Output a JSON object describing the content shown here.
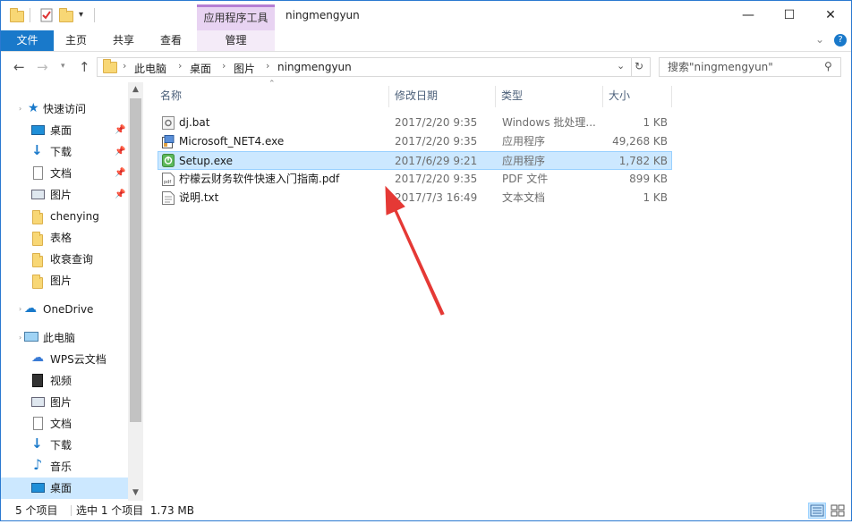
{
  "window": {
    "title": "ningmengyun",
    "contextual_tab_header": "应用程序工具",
    "minimize": "—",
    "maximize": "☐",
    "close": "✕"
  },
  "ribbon": {
    "tabs": [
      "文件",
      "主页",
      "共享",
      "查看",
      "管理"
    ],
    "collapse_icon": "chevron-down-icon",
    "help_icon": "help-icon"
  },
  "address": {
    "breadcrumbs": [
      "此电脑",
      "桌面",
      "图片",
      "ningmengyun"
    ]
  },
  "search": {
    "placeholder": "搜索\"ningmengyun\""
  },
  "navpane": {
    "quick_access": "快速访问",
    "quick_items": [
      "桌面",
      "下载",
      "文档",
      "图片",
      "chenying",
      "表格",
      "收衰查询",
      "图片"
    ],
    "onedrive": "OneDrive",
    "this_pc": "此电脑",
    "pc_items": [
      "WPS云文档",
      "视频",
      "图片",
      "文档",
      "下载",
      "音乐",
      "桌面"
    ]
  },
  "filelist": {
    "columns": [
      "名称",
      "修改日期",
      "类型",
      "大小"
    ],
    "rows": [
      {
        "name": "dj.bat",
        "date": "2017/2/20 9:35",
        "type": "Windows 批处理...",
        "size": "1 KB",
        "icon": "batch-file-icon"
      },
      {
        "name": "Microsoft_NET4.exe",
        "date": "2017/2/20 9:35",
        "type": "应用程序",
        "size": "49,268 KB",
        "icon": "installer-icon"
      },
      {
        "name": "Setup.exe",
        "date": "2017/6/29 9:21",
        "type": "应用程序",
        "size": "1,782 KB",
        "icon": "setup-app-icon"
      },
      {
        "name": "柠檬云财务软件快速入门指南.pdf",
        "date": "2017/2/20 9:35",
        "type": "PDF 文件",
        "size": "899 KB",
        "icon": "pdf-file-icon"
      },
      {
        "name": "说明.txt",
        "date": "2017/7/3 16:49",
        "type": "文本文档",
        "size": "1 KB",
        "icon": "text-file-icon"
      }
    ]
  },
  "status": {
    "item_count": "5 个项目",
    "selection": "选中 1 个项目  1.73 MB"
  },
  "colors": {
    "accent": "#1979ca",
    "selection": "#cce8ff",
    "arrow": "#e53935"
  }
}
